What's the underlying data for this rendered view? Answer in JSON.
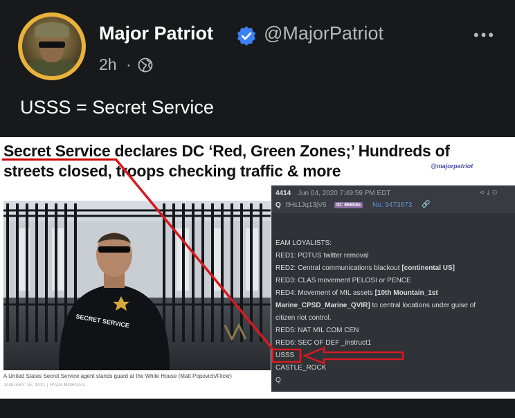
{
  "post": {
    "author_name": "Major Patriot",
    "handle": "@MajorPatriot",
    "time": "2h",
    "separator": "·",
    "more": "•••",
    "text": "USSS = Secret Service"
  },
  "article": {
    "headline_line1": "Secret Service declares DC ‘Red, Green Zones;’ Hundreds of",
    "headline_line2": "streets closed, troops checking traffic & more",
    "watermark": "@majorpatriot",
    "photo_caption": "A United States Secret Service agent stands guard at the White House (Matt Popovich/Flickr)",
    "byline": "JANUARY 15, 2021  |  RYAN MORGAN",
    "vest_text": "SECRET SERVICE"
  },
  "qpost": {
    "post_number": "4414",
    "date": "Jun 04, 2020 7:49:59 PM EDT",
    "q": "Q",
    "tripcode": "!!Hs1Jq13jV6",
    "id_badge": "ID: 866b8a",
    "post_no": "No. 9473673",
    "lines": {
      "l1": "EAM LOYALISTS:",
      "l2": "RED1: POTUS twitter removal",
      "l3a": "RED2: Central communications blackout ",
      "l3b": "[continental US]",
      "l4": "RED3: CLAS movement PELOSI or PENCE",
      "l5a": "RED4: Movement of MIL assets ",
      "l5b": "[10th Mountain_1st",
      "l6a": "Marine_CPSD_Marine_QVIR]",
      "l6b": " to central locations under guise of",
      "l7": "citizen riot control.",
      "l8": "RED5: NAT MIL COM CEN",
      "l9": "RED6: SEC OF DEF _instruct1",
      "l10": "USSS",
      "l11": "CASTLE_ROCK",
      "l12": "Q"
    }
  },
  "colors": {
    "background": "#18191a",
    "verified": "#3b82f6",
    "annotation_red": "#d71920",
    "qpost_bg": "#2f3237",
    "link_blue": "#5b8fd6"
  }
}
